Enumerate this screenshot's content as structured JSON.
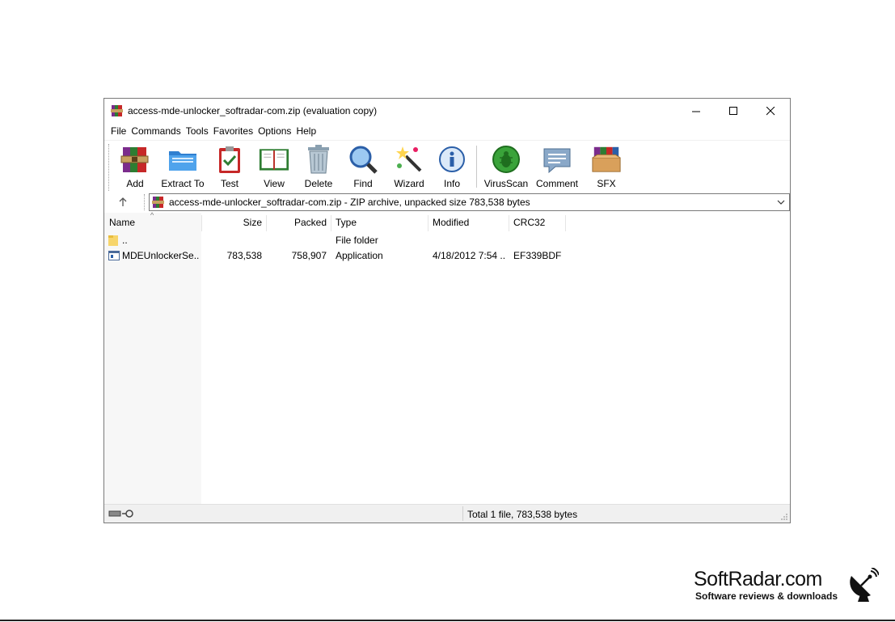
{
  "window": {
    "title": "access-mde-unlocker_softradar-com.zip (evaluation copy)"
  },
  "menu": [
    "File",
    "Commands",
    "Tools",
    "Favorites",
    "Options",
    "Help"
  ],
  "toolbar": {
    "buttons": [
      {
        "label": "Add",
        "icon": "archive-books-icon"
      },
      {
        "label": "Extract To",
        "icon": "folder-extract-icon"
      },
      {
        "label": "Test",
        "icon": "clipboard-check-icon"
      },
      {
        "label": "View",
        "icon": "open-book-icon"
      },
      {
        "label": "Delete",
        "icon": "trash-can-icon"
      },
      {
        "label": "Find",
        "icon": "magnifier-icon"
      },
      {
        "label": "Wizard",
        "icon": "magic-wand-icon"
      },
      {
        "label": "Info",
        "icon": "info-icon"
      },
      {
        "label": "VirusScan",
        "icon": "bug-scan-icon"
      },
      {
        "label": "Comment",
        "icon": "comment-icon"
      },
      {
        "label": "SFX",
        "icon": "sfx-box-icon"
      }
    ]
  },
  "address": {
    "text": "access-mde-unlocker_softradar-com.zip - ZIP archive, unpacked size 783,538 bytes"
  },
  "columns": {
    "name": "Name",
    "size": "Size",
    "packed": "Packed",
    "type": "Type",
    "modified": "Modified",
    "crc": "CRC32"
  },
  "rows": [
    {
      "name": "..",
      "size": "",
      "packed": "",
      "type": "File folder",
      "modified": "",
      "crc": "",
      "icon": "folder-icon"
    },
    {
      "name": "MDEUnlockerSe...",
      "size": "783,538",
      "packed": "758,907",
      "type": "Application",
      "modified": "4/18/2012 7:54 ...",
      "crc": "EF339BDF",
      "icon": "application-icon"
    }
  ],
  "status": {
    "text": "Total 1 file, 783,538 bytes"
  },
  "watermark": {
    "title": "SoftRadar.com",
    "subtitle": "Software reviews & downloads"
  }
}
